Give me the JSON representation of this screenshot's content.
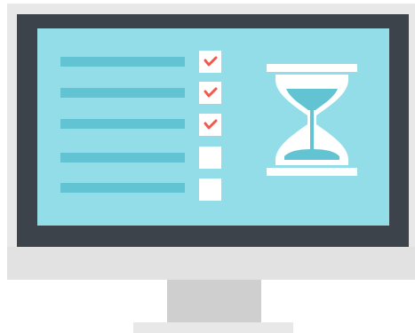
{
  "illustration": {
    "subject": "monitor-with-checklist-and-hourglass",
    "colors": {
      "screen": "#93dde8",
      "bezel": "#3c434a",
      "frame": "#e8e8e8",
      "stand": "#cfcfcf",
      "list_line": "#62c4d3",
      "checkbox": "#ffffff",
      "check_mark": "#f15a4a",
      "sand": "#62c4d3"
    },
    "checklist": [
      {
        "checked": true
      },
      {
        "checked": true
      },
      {
        "checked": true
      },
      {
        "checked": false
      },
      {
        "checked": false
      }
    ],
    "icons": [
      "check-icon",
      "hourglass-icon"
    ]
  }
}
